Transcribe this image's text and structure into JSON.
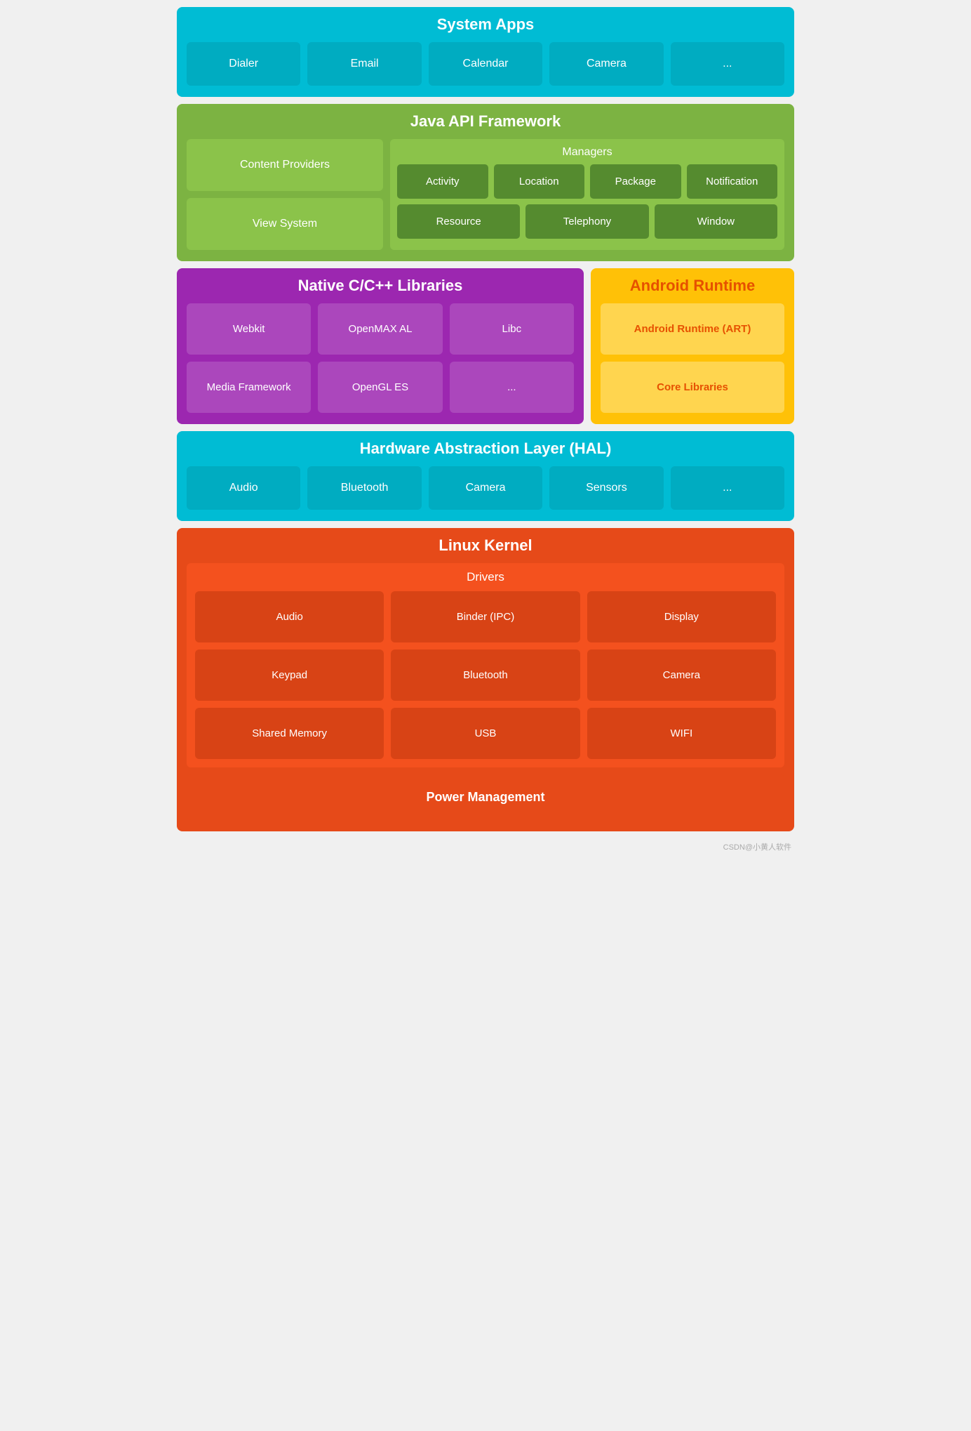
{
  "systemApps": {
    "title": "System Apps",
    "apps": [
      "Dialer",
      "Email",
      "Calendar",
      "Camera",
      "..."
    ]
  },
  "javaApi": {
    "title": "Java API Framework",
    "leftCards": [
      "Content Providers",
      "View System"
    ],
    "managers": {
      "title": "Managers",
      "row1": [
        "Activity",
        "Location",
        "Package",
        "Notification"
      ],
      "row2": [
        "Resource",
        "Telephony",
        "Window"
      ]
    }
  },
  "nativeLibs": {
    "title": "Native C/C++ Libraries",
    "cards": [
      "Webkit",
      "OpenMAX AL",
      "Libc",
      "Media Framework",
      "OpenGL ES",
      "..."
    ]
  },
  "androidRuntime": {
    "title": "Android Runtime",
    "cards": [
      "Android Runtime (ART)",
      "Core Libraries"
    ]
  },
  "hal": {
    "title": "Hardware Abstraction Layer (HAL)",
    "cards": [
      "Audio",
      "Bluetooth",
      "Camera",
      "Sensors",
      "..."
    ]
  },
  "linuxKernel": {
    "title": "Linux Kernel",
    "drivers": {
      "title": "Drivers",
      "cards": [
        "Audio",
        "Binder (IPC)",
        "Display",
        "Keypad",
        "Bluetooth",
        "Camera",
        "Shared Memory",
        "USB",
        "WIFI"
      ]
    },
    "powerManagement": "Power Management"
  },
  "watermark": "CSDN@小黄人软件"
}
